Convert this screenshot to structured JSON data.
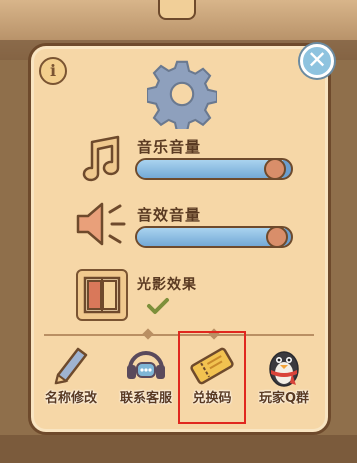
{
  "settings": {
    "music_volume_label": "音乐音量",
    "music_volume_level": 0.95,
    "sfx_volume_label": "音效音量",
    "sfx_volume_level": 0.96,
    "light_shadow_label": "光影效果",
    "light_shadow_enabled": true,
    "info_icon_text": "i"
  },
  "actions": [
    {
      "label": "名称修改",
      "icon": "pencil-icon"
    },
    {
      "label": "联系客服",
      "icon": "headset-icon"
    },
    {
      "label": "兑换码",
      "icon": "ticket-icon"
    },
    {
      "label": "玩家Q群",
      "icon": "penguin-icon"
    }
  ],
  "colors": {
    "panel": "#f6d7a7",
    "border": "#6e4a2c",
    "slider_fill": "#8cc0e6",
    "knob": "#d98e6a",
    "highlight": "#e0281f"
  }
}
